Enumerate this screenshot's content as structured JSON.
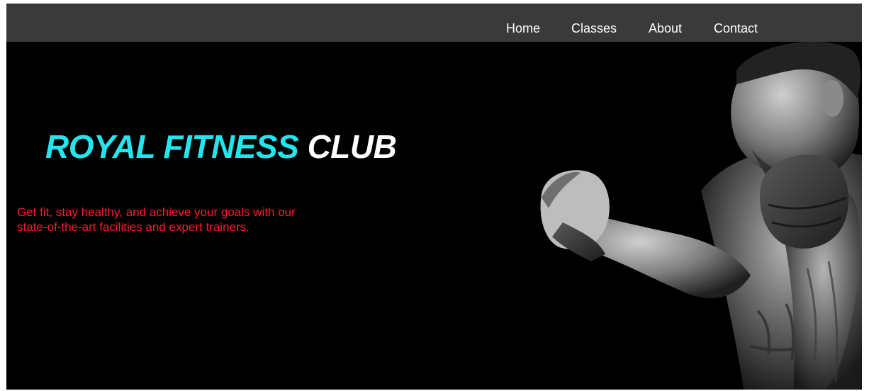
{
  "nav": {
    "items": [
      {
        "label": "Home"
      },
      {
        "label": "Classes"
      },
      {
        "label": "About"
      },
      {
        "label": "Contact"
      }
    ]
  },
  "hero": {
    "title_accent": "ROYAL FITNESS",
    "title_main": "CLUB",
    "tagline_line1": "Get fit, stay healthy, and achieve your goals with our",
    "tagline_line2": "state-of-the-art facilities and expert trainers.",
    "image_subject": "boxer-photo"
  },
  "colors": {
    "nav_bg": "#3a3a3a",
    "hero_bg": "#000000",
    "title_accent": "#22e6ee",
    "title_main": "#ffffff",
    "tagline": "#ff1a2a"
  }
}
